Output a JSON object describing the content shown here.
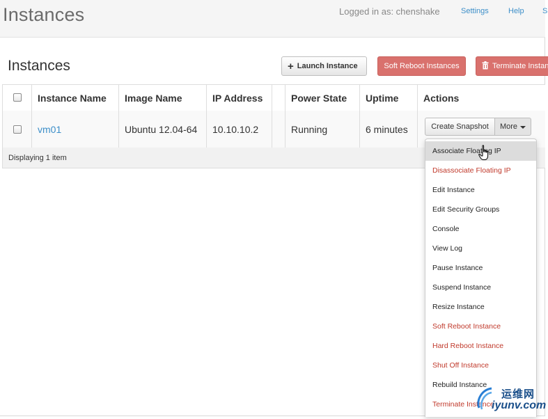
{
  "header": {
    "title": "Instances",
    "logged_in": "Logged in as: chenshake",
    "settings_label": "Settings",
    "help_label": "Help",
    "signout_label": "S"
  },
  "section": {
    "title": "Instances"
  },
  "toolbar": {
    "launch_label": "Launch Instance",
    "soft_reboot_label": "Soft Reboot Instances",
    "terminate_label": "Terminate Instan"
  },
  "table": {
    "columns": [
      "Instance Name",
      "Image Name",
      "IP Address",
      "",
      "Power State",
      "Uptime",
      "Actions"
    ],
    "rows": [
      {
        "instance_name": "vm01",
        "image_name": "Ubuntu 12.04-64",
        "ip_address": "10.10.10.2",
        "extra": "",
        "power_state": "Running",
        "uptime": "6 minutes"
      }
    ],
    "footer": "Displaying 1 item"
  },
  "actions": {
    "snapshot_label": "Create Snapshot",
    "more_label": "More"
  },
  "menu": {
    "items": [
      {
        "label": "Associate Floating IP",
        "danger": false
      },
      {
        "label": "Disassociate Floating IP",
        "danger": true
      },
      {
        "label": "Edit Instance",
        "danger": false
      },
      {
        "label": "Edit Security Groups",
        "danger": false
      },
      {
        "label": "Console",
        "danger": false
      },
      {
        "label": "View Log",
        "danger": false
      },
      {
        "label": "Pause Instance",
        "danger": false
      },
      {
        "label": "Suspend Instance",
        "danger": false
      },
      {
        "label": "Resize Instance",
        "danger": false
      },
      {
        "label": "Soft Reboot Instance",
        "danger": true
      },
      {
        "label": "Hard Reboot Instance",
        "danger": true
      },
      {
        "label": "Shut Off Instance",
        "danger": true
      },
      {
        "label": "Rebuild Instance",
        "danger": false
      },
      {
        "label": "Terminate Instance",
        "danger": true
      }
    ]
  },
  "watermark": {
    "cn": "运维网",
    "en": "iyunv.com"
  },
  "colors": {
    "link": "#3d8fc9",
    "danger": "#c0392b",
    "danger_button": "#d9716d"
  }
}
